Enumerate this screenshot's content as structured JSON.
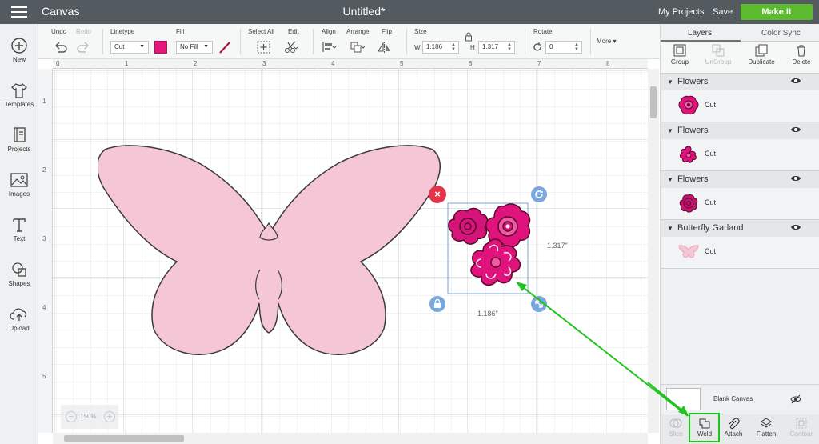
{
  "header": {
    "app_title": "Canvas",
    "doc_title": "Untitled*",
    "my_projects": "My Projects",
    "save": "Save",
    "make_it": "Make It"
  },
  "leftbar": {
    "items": [
      {
        "label": "New",
        "icon": "plus-circle-icon"
      },
      {
        "label": "Templates",
        "icon": "tshirt-icon"
      },
      {
        "label": "Projects",
        "icon": "projects-icon"
      },
      {
        "label": "Images",
        "icon": "image-icon"
      },
      {
        "label": "Text",
        "icon": "text-icon"
      },
      {
        "label": "Shapes",
        "icon": "shapes-icon"
      },
      {
        "label": "Upload",
        "icon": "upload-cloud-icon"
      }
    ]
  },
  "toolbar": {
    "undo": "Undo",
    "redo": "Redo",
    "linetype_label": "Linetype",
    "linetype_value": "Cut",
    "fill_label": "Fill",
    "fill_value": "No Fill",
    "select_all": "Select All",
    "edit": "Edit",
    "align": "Align",
    "arrange": "Arrange",
    "flip": "Flip",
    "size_label": "Size",
    "width_prefix": "W",
    "width_value": "1.186",
    "height_prefix": "H",
    "height_value": "1.317",
    "rotate_label": "Rotate",
    "rotate_value": "0",
    "more": "More",
    "linetype_color": "#e5167b"
  },
  "canvas": {
    "ruler_top": [
      "0",
      "1",
      "2",
      "3",
      "4",
      "5",
      "6",
      "7",
      "8"
    ],
    "ruler_left": [
      "1",
      "2",
      "3",
      "4",
      "5"
    ],
    "zoom": "150%",
    "height_dim": "1.317\"",
    "width_dim": "1.186\""
  },
  "right_panel": {
    "tabs": [
      "Layers",
      "Color Sync"
    ],
    "actions": [
      {
        "label": "Group",
        "enabled": true
      },
      {
        "label": "UnGroup",
        "enabled": false
      },
      {
        "label": "Duplicate",
        "enabled": true
      },
      {
        "label": "Delete",
        "enabled": true
      }
    ],
    "layers": [
      {
        "name": "Flowers",
        "sub": "Cut"
      },
      {
        "name": "Flowers",
        "sub": "Cut"
      },
      {
        "name": "Flowers",
        "sub": "Cut"
      },
      {
        "name": "Butterfly Garland",
        "sub": "Cut"
      }
    ],
    "blank_canvas": "Blank Canvas",
    "bottom_tools": [
      {
        "label": "Slice",
        "enabled": false
      },
      {
        "label": "Weld",
        "enabled": true
      },
      {
        "label": "Attach",
        "enabled": true
      },
      {
        "label": "Flatten",
        "enabled": true
      },
      {
        "label": "Contour",
        "enabled": false
      }
    ]
  },
  "colors": {
    "topbar": "#535a60",
    "make_it": "#5cbb2e",
    "butterfly_fill": "#f5c6d5",
    "flower_fill": "#d6157a",
    "highlight": "#1fc51f"
  }
}
